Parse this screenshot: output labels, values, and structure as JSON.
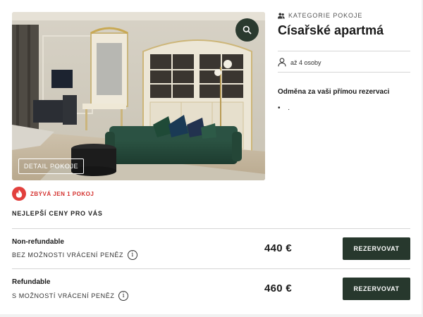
{
  "room": {
    "category_label": "KATEGORIE POKOJE",
    "title": "Císařské apartmá",
    "occupancy": "až 4 osoby",
    "reward_text": "Odměna za vaši přímou rezervaci",
    "reward_dots": "• .",
    "detail_button": "DETAIL POKOJE"
  },
  "availability": {
    "text": "ZBÝVÁ JEN 1 POKOJ"
  },
  "best_prices": "NEJLEPŠÍ CENY PRO VÁS",
  "rates": [
    {
      "name": "Non-refundable",
      "note": "BEZ MOŽNOSTI VRÁCENÍ PENĚZ",
      "price": "440 €",
      "button": "REZERVOVAT"
    },
    {
      "name": "Refundable",
      "note": "S MOŽNOSTÍ VRÁCENÍ PENĚZ",
      "price": "460 €",
      "button": "REZERVOVAT"
    }
  ],
  "icons": {
    "zoom": "search-icon",
    "category": "people-icon",
    "occupancy": "person-icon",
    "availability": "flame-icon",
    "info": "info-icon"
  },
  "colors": {
    "accent_dark_green": "#27382d",
    "alert_red": "#d4312e"
  }
}
